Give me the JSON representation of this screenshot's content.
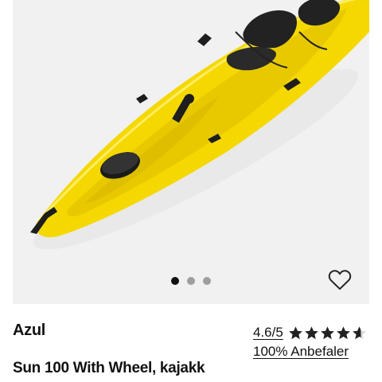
{
  "product": {
    "brand": "Azul",
    "name": "Sun 100 With Wheel, kajakk",
    "rating": "4.6/5",
    "rating_value": 4.6,
    "rating_max": 5,
    "recommend": "100% Anbefaler"
  },
  "gallery": {
    "image_count": 3,
    "active_index": 0,
    "image_subject": "yellow kayak"
  },
  "icons": {
    "favorite": "heart-outline-icon",
    "star": "star-icon"
  },
  "colors": {
    "kayak_yellow": "#f5d800",
    "star_color": "#222222",
    "panel_bg": "#f1f1f1",
    "dot_active": "#111111",
    "dot_inactive": "#9e9e9e"
  }
}
